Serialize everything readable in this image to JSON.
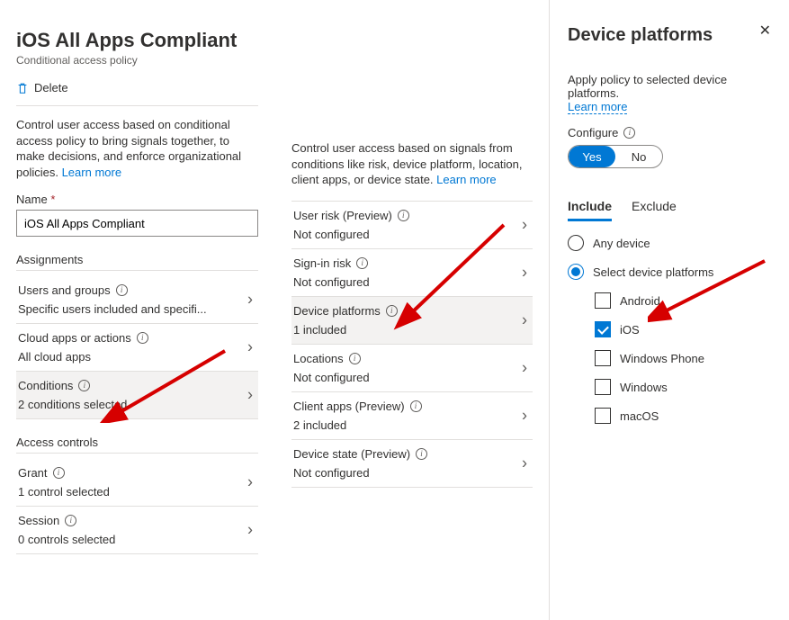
{
  "header": {
    "title": "iOS All Apps Compliant",
    "subtitle": "Conditional access policy",
    "delete_label": "Delete"
  },
  "col1": {
    "intro_text": "Control user access based on conditional access policy to bring signals together, to make decisions, and enforce organizational policies. ",
    "learn_more": "Learn more",
    "name_label": "Name",
    "name_value": "iOS All Apps Compliant",
    "assignments_header": "Assignments",
    "rows": {
      "users": {
        "title": "Users and groups",
        "sub": "Specific users included and specifi..."
      },
      "apps": {
        "title": "Cloud apps or actions",
        "sub": "All cloud apps"
      },
      "conditions": {
        "title": "Conditions",
        "sub": "2 conditions selected"
      }
    },
    "access_header": "Access controls",
    "access_rows": {
      "grant": {
        "title": "Grant",
        "sub": "1 control selected"
      },
      "session": {
        "title": "Session",
        "sub": "0 controls selected"
      }
    }
  },
  "col2": {
    "intro_text": "Control user access based on signals from conditions like risk, device platform, location, client apps, or device state. ",
    "learn_more": "Learn more",
    "rows": {
      "user_risk": {
        "title": "User risk (Preview)",
        "sub": "Not configured"
      },
      "signin_risk": {
        "title": "Sign-in risk",
        "sub": "Not configured"
      },
      "device_platforms": {
        "title": "Device platforms",
        "sub": "1 included"
      },
      "locations": {
        "title": "Locations",
        "sub": "Not configured"
      },
      "client_apps": {
        "title": "Client apps (Preview)",
        "sub": "2 included"
      },
      "device_state": {
        "title": "Device state (Preview)",
        "sub": "Not configured"
      }
    }
  },
  "panel": {
    "title": "Device platforms",
    "apply_text": "Apply policy to selected device platforms. ",
    "learn_more": "Learn more",
    "configure_label": "Configure",
    "yes": "Yes",
    "no": "No",
    "tab_include": "Include",
    "tab_exclude": "Exclude",
    "any_device": "Any device",
    "select_platforms": "Select device platforms",
    "platforms": {
      "android": "Android",
      "ios": "iOS",
      "winphone": "Windows Phone",
      "windows": "Windows",
      "macos": "macOS"
    }
  }
}
